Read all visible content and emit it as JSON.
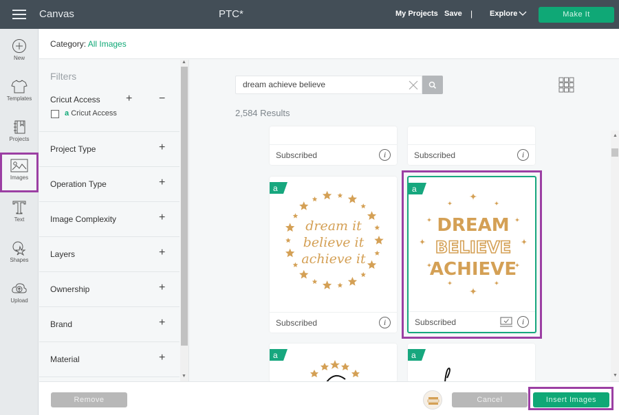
{
  "topbar": {
    "app_name": "Canvas",
    "project_name": "PTC*",
    "my_projects": "My Projects",
    "save": "Save",
    "separator": "|",
    "explore": "Explore",
    "make_it": "Make It"
  },
  "leftnav": {
    "items": [
      {
        "label": "New",
        "icon": "plus-circle-icon"
      },
      {
        "label": "Templates",
        "icon": "shirt-icon"
      },
      {
        "label": "Projects",
        "icon": "notebook-icon"
      },
      {
        "label": "Images",
        "icon": "image-icon",
        "active": true
      },
      {
        "label": "Text",
        "icon": "text-icon"
      },
      {
        "label": "Shapes",
        "icon": "shapes-icon"
      },
      {
        "label": "Upload",
        "icon": "cloud-upload-icon"
      }
    ]
  },
  "category": {
    "label": "Category:",
    "value": "All Images"
  },
  "filters": {
    "title": "Filters",
    "cricut_access": {
      "heading": "Cricut Access",
      "checkbox_label": "Cricut Access",
      "checked": false
    },
    "groups": [
      "Project Type",
      "Operation Type",
      "Image Complexity",
      "Layers",
      "Ownership",
      "Brand",
      "Material"
    ]
  },
  "search": {
    "value": "dream achieve believe",
    "results": "2,584 Results"
  },
  "cards": [
    {
      "status": "Subscribed"
    },
    {
      "status": "Subscribed"
    },
    {
      "status": "Subscribed",
      "image": "dream it believe it achieve it",
      "access_badge": "a"
    },
    {
      "status": "Subscribed",
      "image": "DREAM BELIEVE ACHIEVE",
      "access_badge": "a",
      "selected": true
    },
    {
      "access_badge": "a"
    },
    {
      "access_badge": "a"
    }
  ],
  "card_text": {
    "c3_line1": "dream it",
    "c3_line2": "believe it",
    "c3_line3": "achieve it",
    "c4_line1": "DREAM",
    "c4_line2": "BELIEVE",
    "c4_line3": "ACHIEVE",
    "badge": "a",
    "info": "i"
  },
  "bottombar": {
    "remove": "Remove",
    "cancel": "Cancel",
    "insert": "Insert Images"
  },
  "colors": {
    "accent": "#0fa876",
    "highlight": "#9b3fa3",
    "image_gold": "#d4a055",
    "topbar": "#434e57"
  }
}
